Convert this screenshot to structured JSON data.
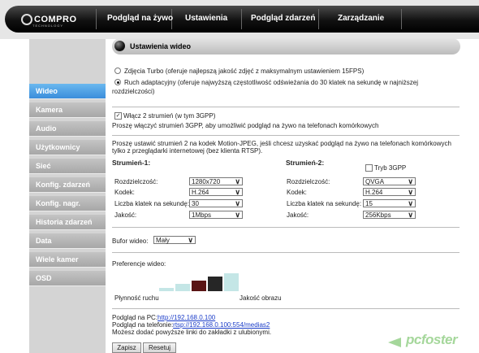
{
  "brand": {
    "name": "COMPRO",
    "sub": "TECHNOLOGY"
  },
  "nav": [
    "Podgląd na żywo",
    "Ustawienia",
    "Podgląd zdarzeń",
    "Zarządzanie"
  ],
  "sidebar": [
    "Wideo",
    "Kamera",
    "Audio",
    "Użytkownicy",
    "Sieć",
    "Konfig. zdarzeń",
    "Konfig. nagr.",
    "Historia zdarzeń",
    "Data",
    "Wiele kamer",
    "OSD"
  ],
  "section_title": "Ustawienia wideo",
  "mode": {
    "turbo": "Zdjęcia Turbo (oferuje najlepszą jakość zdjęć z maksymalnym ustawieniem 15FPS)",
    "adaptive_line1": "Ruch adaptacyjny (oferuje najwyższą częstotliwość odświeżania do 30 klatek na sekundę w najniższej",
    "adaptive_line2": "rozdzielczości)",
    "selected": "adaptive"
  },
  "dual_stream": {
    "label": "Włącz 2 strumień (w tym 3GPP)",
    "checked": true,
    "hint": "Proszę włączyć strumień 3GPP, aby umożliwić podgląd na żywo na telefonach komórkowych"
  },
  "info_line1": "Proszę ustawić strumień 2 na kodek Motion-JPEG, jeśli chcesz uzyskać podgląd na żywo na telefonach komórkowych",
  "info_line2": "tylko z przeglądarki internetowej (bez klienta RTSP).",
  "fields": {
    "resolution": "Rozdzielczość:",
    "codec": "Kodek:",
    "fps": "Liczba klatek na sekundę:",
    "quality": "Jakość:"
  },
  "stream1": {
    "title": "Strumień-1:",
    "resolution": "1280x720",
    "codec": "H.264",
    "fps": "30",
    "quality": "1Mbps"
  },
  "stream2": {
    "title": "Strumień-2:",
    "mode3gp": "Tryb 3GPP",
    "mode3gp_checked": false,
    "resolution": "QVGA",
    "codec": "H.264",
    "fps": "15",
    "quality": "256Kbps"
  },
  "buffer": {
    "label": "Bufor wideo:",
    "value": "Mały"
  },
  "preference": {
    "label": "Preferencje wideo:",
    "left": "Płynność ruchu",
    "right": "Jakość obrazu",
    "levels": 5,
    "selected": 3,
    "colors": {
      "bar": "#c4e6e6",
      "selected": "#5a1414",
      "dark": "#262626"
    }
  },
  "links": {
    "pc_label": "Podgląd na PC:",
    "pc_url": "http://192.168.0.100",
    "phone_label": "Podgląd na telefonie:",
    "phone_url": "rtsp://192.168.0.100:554/medias2",
    "note": "Możesz dodać powyższe linki do zakładki z ulubionymi."
  },
  "buttons": {
    "save": "Zapisz",
    "reset": "Resetuj"
  },
  "watermark": "pcfoster"
}
